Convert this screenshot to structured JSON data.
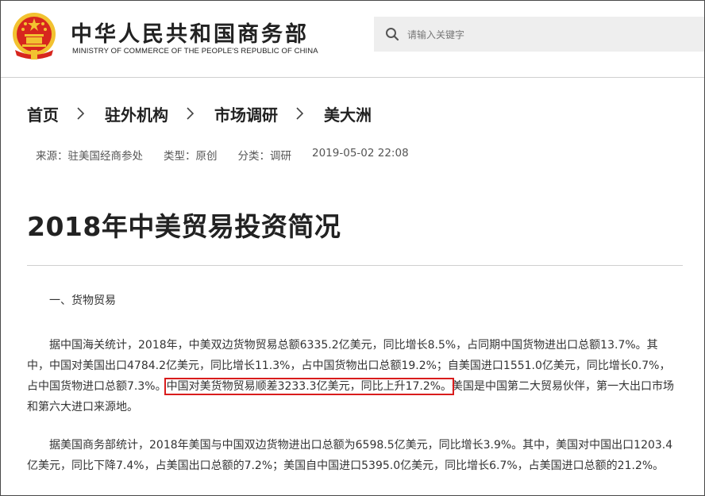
{
  "header": {
    "site_title": "中华人民共和国商务部",
    "site_subtitle": "MINISTRY OF COMMERCE OF THE PEOPLE'S REPUBLIC OF CHINA",
    "emblem_icon": "national-emblem-icon",
    "search": {
      "placeholder": "请输入关键字",
      "icon": "search-icon"
    }
  },
  "breadcrumb": {
    "items": [
      "首页",
      "驻外机构",
      "市场调研",
      "美大洲"
    ]
  },
  "meta": {
    "source": "来源：驻美国经商参处",
    "type": "类型：原创",
    "category": "分类：调研",
    "date": "2019-05-02 22:08"
  },
  "article": {
    "title": "2018年中美贸易投资简况",
    "section_1": "一、货物贸易",
    "p1_before": "据中国海关统计，2018年，中美双边货物贸易总额6335.2亿美元，同比增长8.5%，占同期中国货物进出口总额13.7%。其中，中国对美国出口4784.2亿美元，同比增长11.3%，占中国货物出口总额19.2%；自美国进口1551.0亿美元，同比增长0.7%，占中国货物进口总额7.3%。",
    "p1_highlight": "中国对美货物贸易顺差3233.3亿美元，同比上升17.2%。",
    "p1_after": "美国是中国第二大贸易伙伴，第一大出口市场和第六大进口来源地。",
    "p2": "据美国商务部统计，2018年美国与中国双边货物进出口总额为6598.5亿美元，同比增长3.9%。其中，美国对中国出口1203.4亿美元，同比下降7.4%，占美国出口总额的7.2%；美国自中国进口5395.0亿美元，同比增长6.7%，占美国进口总额的21.2%。"
  },
  "colors": {
    "highlight_border": "#d91c1c",
    "emblem_red": "#d7261e",
    "emblem_gold": "#f2c230"
  }
}
